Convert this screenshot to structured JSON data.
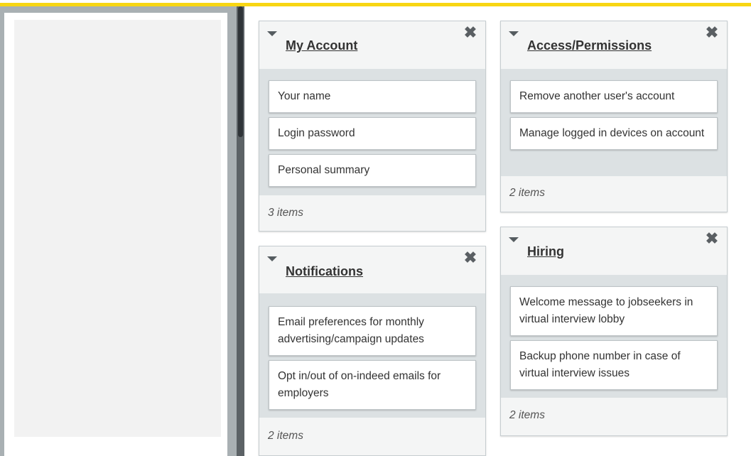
{
  "colors": {
    "accent": "#f8d613",
    "sidebar": "#a9b0b3",
    "card_body": "#dce1e3"
  },
  "cards": {
    "my_account": {
      "title": "My Account",
      "items": [
        "Your name",
        "Login password",
        "Personal summary"
      ],
      "count": "3 items"
    },
    "notifications": {
      "title": "Notifications",
      "items": [
        "Email preferences for monthly advertising/campaign updates",
        "Opt in/out of on-indeed emails for employers"
      ],
      "count": "2 items"
    },
    "access": {
      "title": "Access/Permissions",
      "items": [
        "Remove another user's account",
        "Manage logged in devices on account"
      ],
      "count": "2 items"
    },
    "hiring": {
      "title": "Hiring",
      "items": [
        "Welcome message to jobseekers in virtual interview lobby",
        "Backup phone number in case of virtual interview issues"
      ],
      "count": "2 items"
    }
  },
  "icons": {
    "collapse": "caret-down-icon",
    "close": "close-icon"
  }
}
